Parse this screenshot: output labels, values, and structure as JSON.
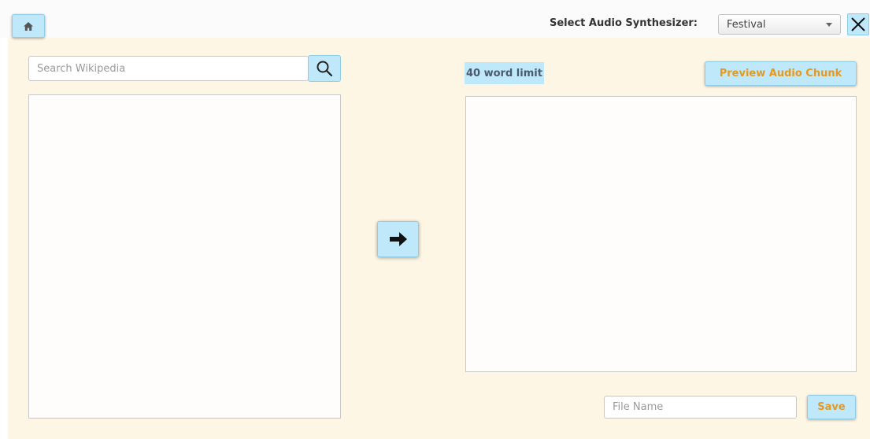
{
  "toolbar": {
    "home_icon": "home-icon",
    "synth_label": "Select Audio Synthesizer:",
    "synth_selected": "Festival",
    "close_icon": "close-icon"
  },
  "search": {
    "placeholder": "Search Wikipedia",
    "value": "",
    "button_icon": "search-icon"
  },
  "transfer": {
    "icon": "arrow-right-icon"
  },
  "chunk": {
    "word_limit_label": "40 word limit",
    "preview_label": "Preview Audio Chunk"
  },
  "save": {
    "filename_placeholder": "File Name",
    "filename_value": "",
    "save_label": "Save"
  },
  "colors": {
    "accent_button_bg": "#bfe9fb",
    "accent_text": "#e39a21",
    "panel_bg": "#fef6e4"
  }
}
